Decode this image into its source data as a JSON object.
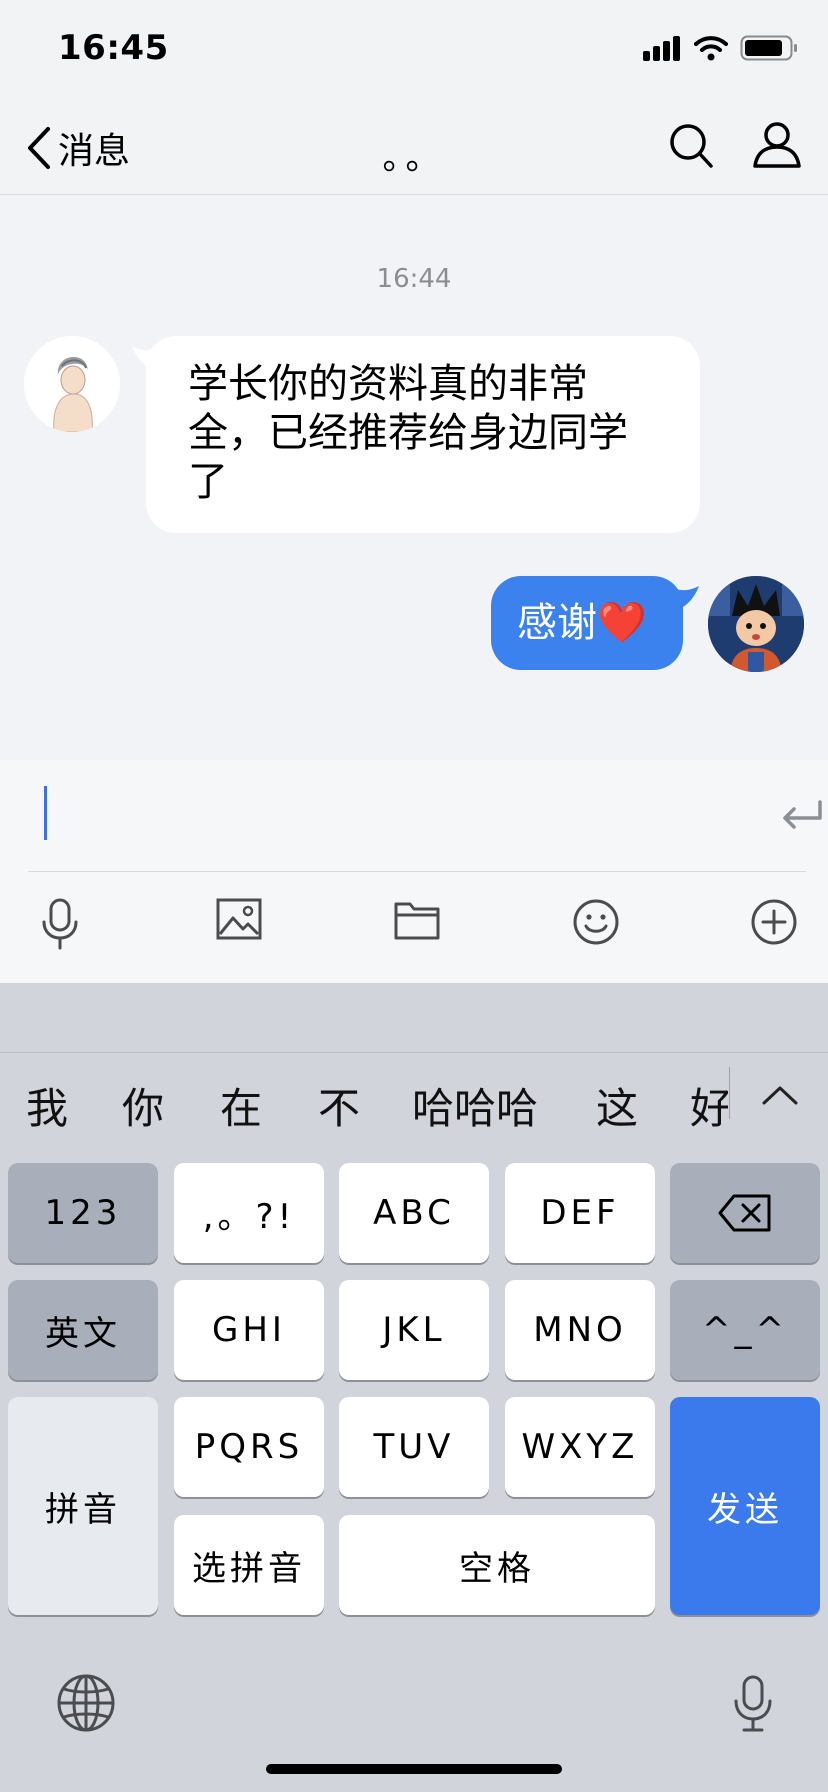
{
  "status_bar": {
    "time": "16:45"
  },
  "nav": {
    "back_label": "消息",
    "title": "。。"
  },
  "chat": {
    "timestamp": "16:44",
    "messages": [
      {
        "direction": "incoming",
        "text": "学长你的资料真的非常全，已经推荐给身边同学了"
      },
      {
        "direction": "outgoing",
        "text": "感谢❤️"
      }
    ]
  },
  "input": {
    "value": "",
    "placeholder": ""
  },
  "toolbar": {
    "icons": [
      "mic-icon",
      "image-icon",
      "folder-icon",
      "emoji-icon",
      "add-icon"
    ]
  },
  "keyboard": {
    "candidates": [
      "我",
      "你",
      "在",
      "不",
      "哈哈哈",
      "这",
      "好"
    ],
    "keys": {
      "num": "123",
      "punct": ",。?!",
      "abc": "ABC",
      "def": "DEF",
      "english": "英文",
      "ghi": "GHI",
      "jkl": "JKL",
      "mno": "MNO",
      "emoticon": "^_^",
      "pinyin": "拼音",
      "pqrs": "PQRS",
      "tuv": "TUV",
      "wxyz": "WXYZ",
      "send": "发送",
      "select_pinyin": "选拼音",
      "space": "空格"
    }
  },
  "colors": {
    "accent": "#3a7aed",
    "bubble_out": "#3b82ef",
    "background": "#f1f3f6"
  }
}
